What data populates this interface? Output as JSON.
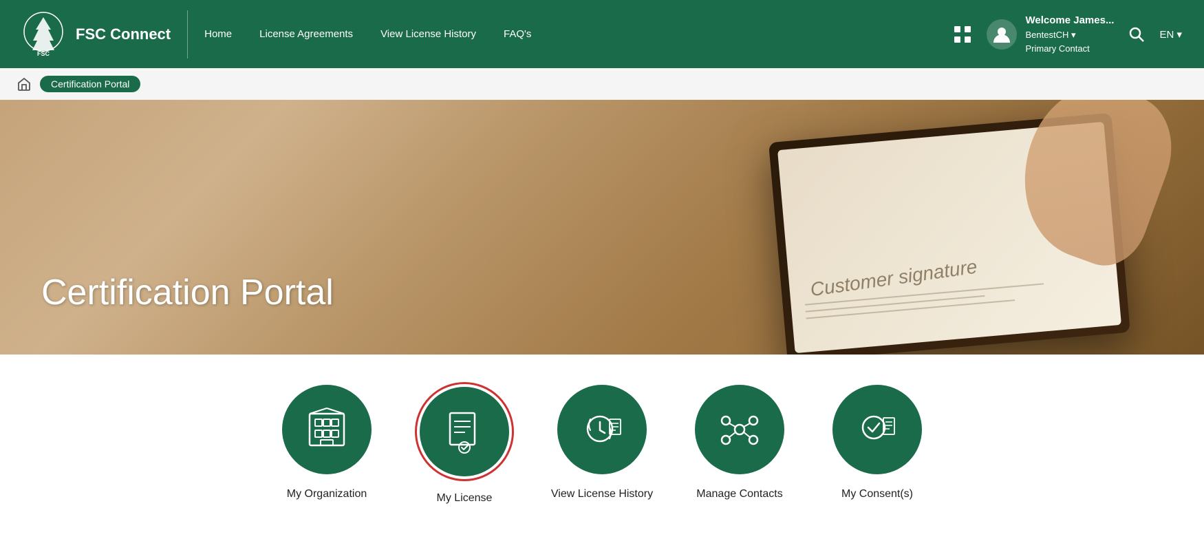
{
  "header": {
    "brand": "FSC Connect",
    "nav": [
      {
        "label": "Home",
        "id": "home"
      },
      {
        "label": "License Agreements",
        "id": "license-agreements"
      },
      {
        "label": "View License History",
        "id": "view-license-history"
      },
      {
        "label": "FAQ's",
        "id": "faqs"
      }
    ],
    "user": {
      "welcome": "Welcome James...",
      "org": "BentestCH ▾",
      "role": "Primary Contact"
    },
    "lang": "EN ▾"
  },
  "breadcrumb": {
    "home_icon": "⌂",
    "current": "Certification Portal"
  },
  "hero": {
    "title": "Certification Portal"
  },
  "portal": {
    "items": [
      {
        "id": "my-org",
        "label": "My Organization",
        "selected": false
      },
      {
        "id": "my-license",
        "label": "My License",
        "selected": true
      },
      {
        "id": "view-license-history",
        "label": "View License History",
        "selected": false
      },
      {
        "id": "manage-contacts",
        "label": "Manage Contacts",
        "selected": false
      },
      {
        "id": "my-consents",
        "label": "My Consent(s)",
        "selected": false
      }
    ]
  }
}
